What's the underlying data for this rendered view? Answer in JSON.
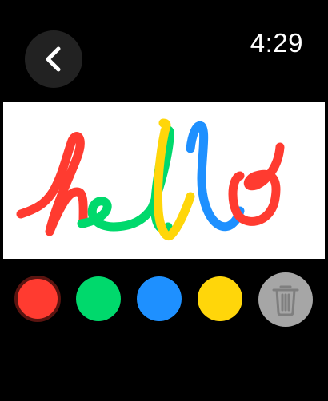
{
  "clock": {
    "time": "4:29"
  },
  "colors": {
    "red": "#ff3b30",
    "green": "#00d96c",
    "blue": "#1e90ff",
    "yellow": "#ffd60a",
    "selected_border": "#5a1410",
    "canvas_background": "#ffffff",
    "button_background": "#222222",
    "trash_background": "#a6a6a6"
  },
  "toolbar": {
    "back_icon": "chevron-left-icon",
    "clear_icon": "trash-icon",
    "selected_color": "red",
    "swatches": [
      {
        "name": "red",
        "color": "#ff3b30",
        "selected": true
      },
      {
        "name": "green",
        "color": "#00d96c",
        "selected": false
      },
      {
        "name": "blue",
        "color": "#1e90ff",
        "selected": false
      },
      {
        "name": "yellow",
        "color": "#ffd60a",
        "selected": false
      }
    ]
  },
  "drawing": {
    "strokes": [
      "red",
      "green",
      "yellow",
      "blue",
      "red"
    ]
  }
}
